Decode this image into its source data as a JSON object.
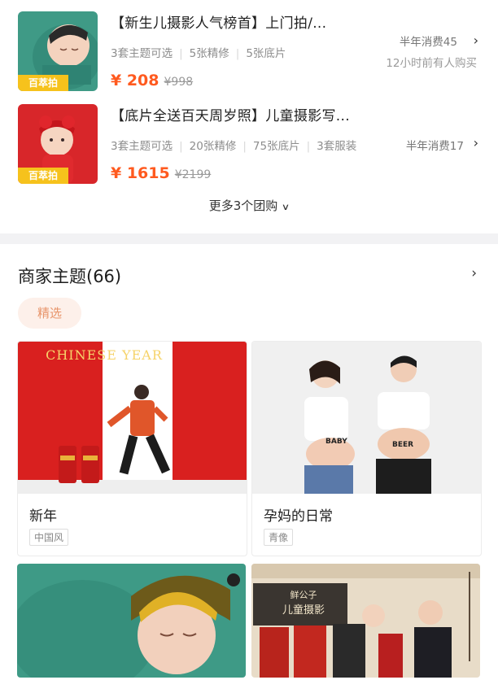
{
  "deals": [
    {
      "badge": "百萃拍",
      "title": "【新生儿摄影人气榜首】上门拍/...",
      "tags": [
        "3套主题可选",
        "5张精修",
        "5张底片"
      ],
      "price": "¥ 208",
      "original_price": "¥998",
      "stat": "半年消费45",
      "recent": "12小时前有人购买"
    },
    {
      "badge": "百萃拍",
      "title": "【底片全送百天周岁照】儿童摄影写...",
      "tags": [
        "3套主题可选",
        "20张精修",
        "75张底片",
        "3套服装"
      ],
      "price": "¥ 1615",
      "original_price": "¥2199",
      "stat": "半年消费17"
    }
  ],
  "more_label": "更多3个团购",
  "section": {
    "title": "商家主题(66)",
    "filter_chip": "精选"
  },
  "themes": [
    {
      "name": "新年",
      "tag": "中国风",
      "banner": "CHINESE YEAR"
    },
    {
      "name": "孕妈的日常",
      "tag": "青像",
      "belly_left": "BABY",
      "belly_right": "BEER"
    },
    {
      "name": ""
    },
    {
      "name": "",
      "logo_line1": "鲜公子",
      "logo_line2": "儿童摄影"
    }
  ],
  "icons": {
    "chevron_right": "chevron-right-icon",
    "chevron_down": "chevron-down-icon"
  },
  "colors": {
    "price": "#ff5a1f",
    "chip_bg": "#fdf0ea",
    "chip_text": "#e8946a",
    "badge": "#f6c21c"
  }
}
